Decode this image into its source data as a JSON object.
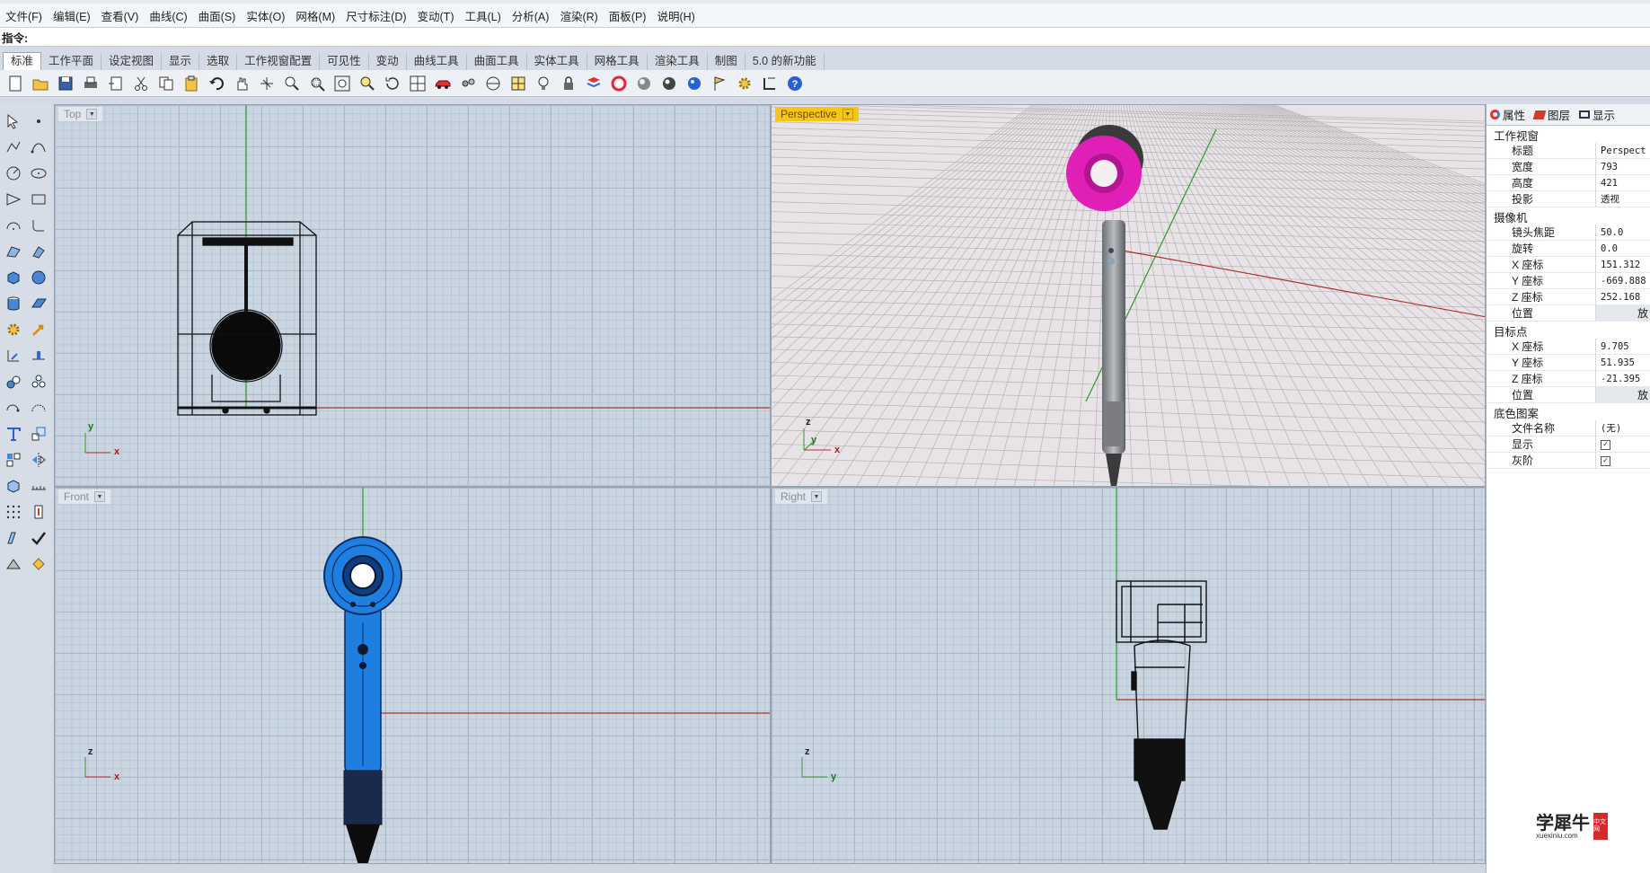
{
  "menu": [
    "文件(F)",
    "编辑(E)",
    "查看(V)",
    "曲线(C)",
    "曲面(S)",
    "实体(O)",
    "网格(M)",
    "尺寸标注(D)",
    "变动(T)",
    "工具(L)",
    "分析(A)",
    "渲染(R)",
    "面板(P)",
    "说明(H)"
  ],
  "command": {
    "label": "指令:",
    "value": ""
  },
  "tabs": [
    "标准",
    "工作平面",
    "设定视图",
    "显示",
    "选取",
    "工作视窗配置",
    "可见性",
    "变动",
    "曲线工具",
    "曲面工具",
    "实体工具",
    "网格工具",
    "渲染工具",
    "制图",
    "5.0 的新功能"
  ],
  "viewports": {
    "top": {
      "title": "Top",
      "axis1": "y",
      "axis2": "x"
    },
    "perspective": {
      "title": "Perspective",
      "axis1": "z",
      "axis2": "y",
      "axis3": "x"
    },
    "front": {
      "title": "Front",
      "axis1": "z",
      "axis2": "x"
    },
    "right": {
      "title": "Right",
      "axis1": "z",
      "axis2": "y"
    }
  },
  "panel": {
    "tabs": {
      "props": "属性",
      "layers": "图层",
      "display": "显示"
    },
    "sections": {
      "viewport": "工作视窗",
      "camera": "摄像机",
      "target": "目标点",
      "background": "底色图案"
    },
    "viewport_rows": [
      {
        "k": "标题",
        "v": "Perspect"
      },
      {
        "k": "宽度",
        "v": "793"
      },
      {
        "k": "高度",
        "v": "421"
      },
      {
        "k": "投影",
        "v": "透视"
      }
    ],
    "camera_rows": [
      {
        "k": "镜头焦距",
        "v": "50.0"
      },
      {
        "k": "旋转",
        "v": "0.0"
      },
      {
        "k": "X 座标",
        "v": "151.312"
      },
      {
        "k": "Y 座标",
        "v": "-669.888"
      },
      {
        "k": "Z 座标",
        "v": "252.168"
      }
    ],
    "camera_pos": {
      "k": "位置",
      "v": "放"
    },
    "target_rows": [
      {
        "k": "X 座标",
        "v": "9.705"
      },
      {
        "k": "Y 座标",
        "v": "51.935"
      },
      {
        "k": "Z 座标",
        "v": "-21.395"
      }
    ],
    "target_pos": {
      "k": "位置",
      "v": "放"
    },
    "background_rows": [
      {
        "k": "文件名称",
        "v": "(无)"
      }
    ],
    "bg_show": {
      "k": "显示",
      "checked": true
    },
    "bg_gray": {
      "k": "灰阶",
      "checked": true
    }
  },
  "watermark": {
    "title": "学犀牛",
    "site": "xuexiniu.com",
    "badge": "中文网"
  },
  "colors": {
    "accent_yellow": "#f6c518",
    "magenta": "#e01fb6",
    "blue_model": "#1e7fe0"
  }
}
